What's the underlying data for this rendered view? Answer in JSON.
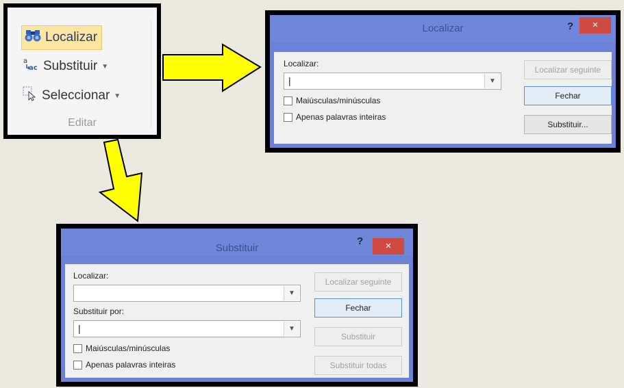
{
  "ribbon": {
    "items": [
      {
        "label": "Localizar",
        "icon": "binoculars-icon"
      },
      {
        "label": "Substituir",
        "icon": "replace-icon"
      },
      {
        "label": "Seleccionar",
        "icon": "cursor-select-icon"
      }
    ],
    "group_name": "Editar"
  },
  "find_dialog": {
    "title": "Localizar",
    "help": "?",
    "close": "×",
    "find_label": "Localizar:",
    "find_value": "|",
    "match_case": "Maiúsculas/minúsculas",
    "whole_words": "Apenas palavras inteiras",
    "btn_find_next": "Localizar seguinte",
    "btn_close": "Fechar",
    "btn_replace": "Substituir..."
  },
  "replace_dialog": {
    "title": "Substituir",
    "help": "?",
    "close": "×",
    "find_label": "Localizar:",
    "find_value": "",
    "replace_label": "Substituir por:",
    "replace_value": "|",
    "match_case": "Maiúsculas/minúsculas",
    "whole_words": "Apenas palavras inteiras",
    "btn_find_next": "Localizar seguinte",
    "btn_close": "Fechar",
    "btn_replace": "Substituir",
    "btn_replace_all": "Substituir todas"
  },
  "colors": {
    "arrow": "#ffff00",
    "dialog_frame": "#6c82d8",
    "close_button": "#cf4a43"
  }
}
